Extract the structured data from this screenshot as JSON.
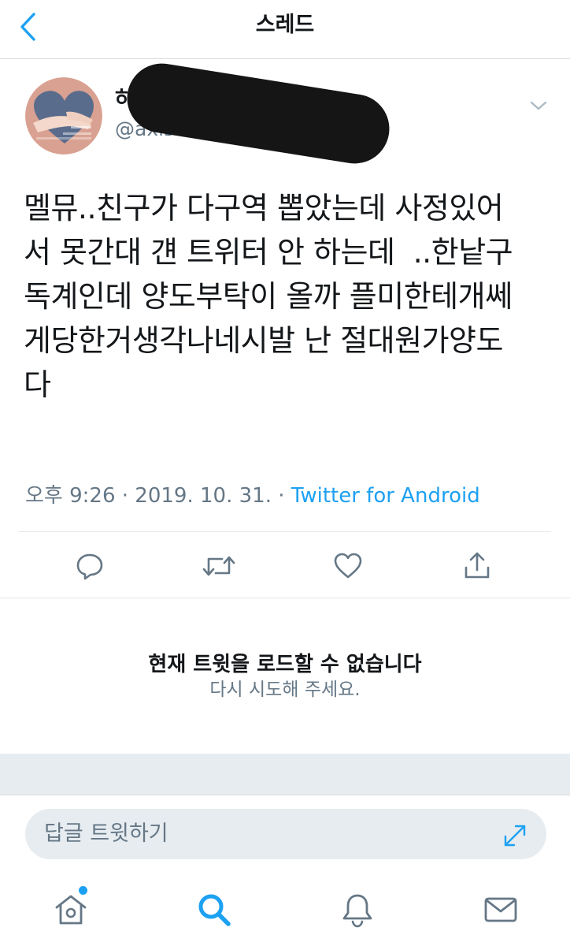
{
  "header": {
    "title": "스레드",
    "back_icon": "chevron-left-icon"
  },
  "colors": {
    "accent": "#1da1f2",
    "secondary_text": "#657786",
    "primary_text": "#14171a",
    "divider": "#e1e8ed",
    "band": "#e6ecf0"
  },
  "tweet": {
    "display_name": "하",
    "handle": "@axisr",
    "text": "멜뮤..친구가 다구역 뽑았는데 사정있어\n서 못간대 걘 트위터 안 하는데  ..한낱구\n독계인데 양도부탁이 올까 플미한테개쎄\n게당한거생각나네시발 난 절대원가양도\n다",
    "time": "오후 9:26",
    "separator": "·",
    "date": "2019. 10. 31.",
    "source": "Twitter for Android"
  },
  "actions": [
    {
      "icon": "reply-icon"
    },
    {
      "icon": "retweet-icon"
    },
    {
      "icon": "like-icon"
    },
    {
      "icon": "share-icon"
    }
  ],
  "error": {
    "title": "현재 트윗을 로드할 수 없습니다",
    "subtitle": "다시 시도해 주세요."
  },
  "reply_bar": {
    "placeholder": "답글 트윗하기",
    "expand_icon": "expand-icon"
  },
  "bottom_nav": [
    {
      "icon": "home-icon",
      "has_notification": true
    },
    {
      "icon": "search-icon",
      "active": true
    },
    {
      "icon": "bell-icon"
    },
    {
      "icon": "mail-icon"
    }
  ]
}
